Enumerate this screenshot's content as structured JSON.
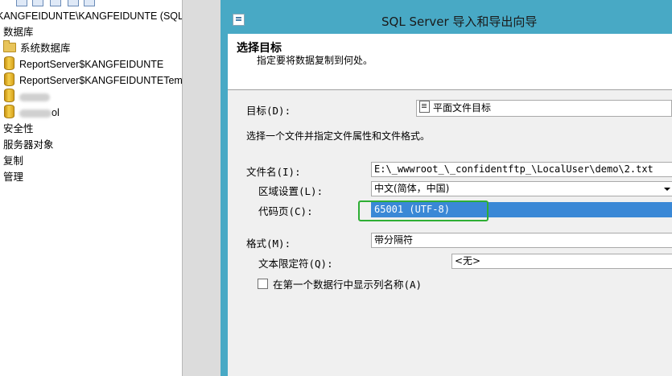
{
  "explorer": {
    "server_label": "KANGFEIDUNTE\\KANGFEIDUNTE (SQL Se",
    "databases_label": "数据库",
    "system_databases_label": "系统数据库",
    "report_server_db_label": "ReportServer$KANGFEIDUNTE",
    "report_server_temp_db_label": "ReportServer$KANGFEIDUNTETem",
    "redacted_db_suffix": "ol",
    "security_label": "安全性",
    "server_objects_label": "服务器对象",
    "replication_label": "复制",
    "management_label": "管理"
  },
  "dialog": {
    "title": "SQL Server 导入和导出向导",
    "header_title": "选择目标",
    "header_subtitle": "指定要将数据复制到何处。",
    "destination_label": "目标(D):",
    "destination_value": "平面文件目标",
    "instruction": "选择一个文件并指定文件属性和文件格式。",
    "filename_label": "文件名(I):",
    "filename_value": "E:\\_wwwroot_\\_confidentftp_\\LocalUser\\demo\\2.txt",
    "locale_label": "区域设置(L):",
    "locale_value": "中文(简体，中国)",
    "codepage_label": "代码页(C):",
    "codepage_value": "65001 (UTF-8)",
    "format_label": "格式(M):",
    "format_value": "带分隔符",
    "text_qualifier_label": "文本限定符(Q):",
    "text_qualifier_value": "<无>",
    "column_names_checkbox_label": "在第一个数据行中显示列名称(A)",
    "column_names_checked": false
  },
  "colors": {
    "dialog_frame": "#48a9c5",
    "selection": "#3a88d6",
    "highlight_box": "#2eae34"
  }
}
